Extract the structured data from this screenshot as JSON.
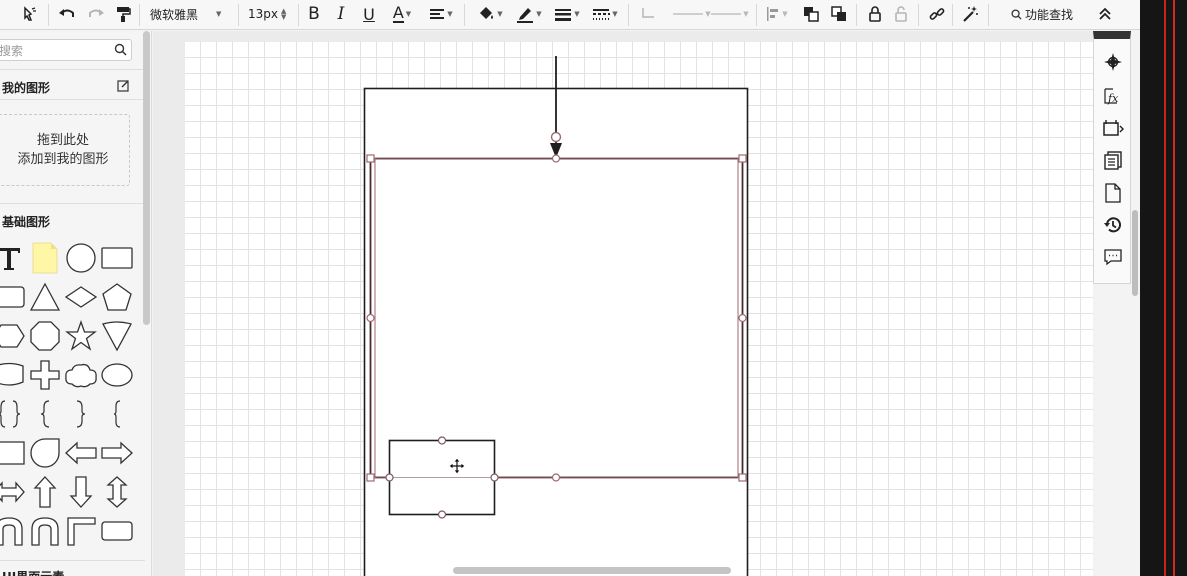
{
  "toolbar": {
    "font_family_value": "微软雅黑",
    "font_size_value": "13px",
    "bold_label": "B",
    "italic_label": "I",
    "underline_label": "U",
    "font_color_label": "A",
    "feature_search_label": "功能查找"
  },
  "sidebar": {
    "search_placeholder": "搜索",
    "my_shapes_title": "我的图形",
    "drop_zone_line1": "拖到此处",
    "drop_zone_line2": "添加到我的图形",
    "basic_shapes_title": "基础图形",
    "bottom_section_title": "UI界面元素"
  },
  "icons": {
    "navigate": "compass-icon",
    "format": "function-icon",
    "page_setup": "page-setup-icon",
    "pages": "pages-icon",
    "blank_page": "page-icon",
    "history": "history-icon",
    "comments": "comment-icon"
  },
  "colors": {
    "selection": "#9e6a72",
    "shape_stroke": "#222222",
    "grid": "#e3e3e3"
  }
}
